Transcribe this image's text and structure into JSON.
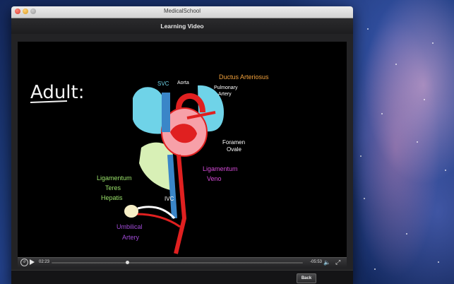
{
  "window": {
    "title": "MedicalSchool",
    "nav_title": "Learning Video"
  },
  "video": {
    "heading": "Adult:",
    "labels": {
      "svc": "SVC",
      "aorta": "Aorta",
      "ductus": "Ductus Arteriosus",
      "pulmonary_1": "Pulmonary",
      "pulmonary_2": "Artery",
      "foramen_1": "Foramen",
      "foramen_2": "Ovale",
      "lig_venosum_1": "Ligamentum",
      "lig_venosum_2": "Veno",
      "lig_teres_1": "Ligamentum",
      "lig_teres_2": "Teres",
      "lig_teres_3": "Hepatis",
      "ivc": "IVC",
      "umbilical_1": "Umbilical",
      "umbilical_2": "Artery"
    }
  },
  "controls": {
    "elapsed": "02:23",
    "remaining": "-05:53",
    "progress": 0.3,
    "replay_icon": "replay-icon",
    "play_icon": "play-icon",
    "volume_icon": "volume-icon",
    "fullscreen_icon": "fullscreen-icon"
  },
  "bottom": {
    "back_label": "Back"
  },
  "colors": {
    "ductus": "#f2a13c",
    "lig_venosum": "#d54bd8",
    "lig_teres": "#9be36b",
    "umbilical": "#a14bd8",
    "artery_red": "#e02020",
    "vein_blue": "#3a86c8",
    "lung_cyan": "#6fd3e8"
  }
}
